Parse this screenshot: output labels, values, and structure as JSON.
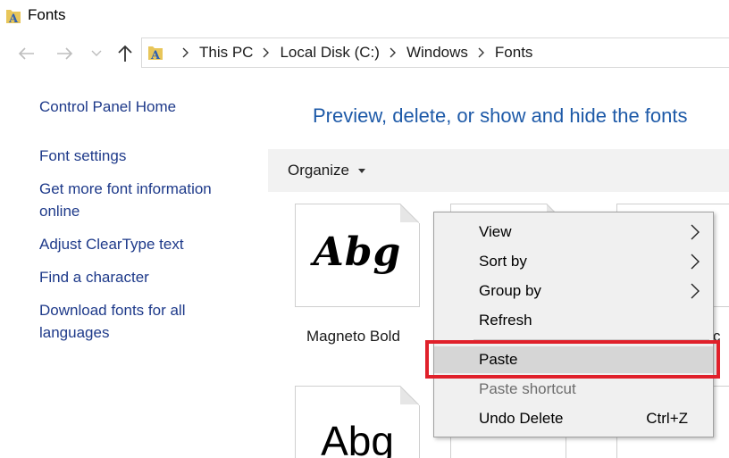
{
  "window": {
    "title": "Fonts",
    "title_icon": "fonts-folder-icon"
  },
  "nav": {
    "back_icon": "arrow-left-icon",
    "forward_icon": "arrow-right-icon",
    "recent_icon": "chevron-down-icon",
    "up_icon": "arrow-up-icon"
  },
  "address": {
    "crumbs": [
      "This PC",
      "Local Disk (C:)",
      "Windows",
      "Fonts"
    ]
  },
  "sidebar": {
    "home": "Control Panel Home",
    "links": [
      "Font settings",
      "Get more font information online",
      "Adjust ClearType text",
      "Find a character",
      "Download fonts for all languages"
    ]
  },
  "main": {
    "heading": "Preview, delete, or show and hide the fonts",
    "organize_label": "Organize",
    "tiles": [
      {
        "name": "Magneto Bold",
        "preview": "Abg"
      },
      {
        "name": "",
        "preview": "Abg"
      }
    ],
    "partial_label_char": "c"
  },
  "context_menu": {
    "items": [
      {
        "label": "View",
        "submenu": true
      },
      {
        "label": "Sort by",
        "submenu": true
      },
      {
        "label": "Group by",
        "submenu": true
      },
      {
        "label": "Refresh"
      },
      {
        "label": "Paste",
        "highlighted": true
      },
      {
        "label": "Paste shortcut",
        "disabled": true
      },
      {
        "label": "Undo Delete",
        "accelerator": "Ctrl+Z"
      }
    ]
  },
  "colors": {
    "link": "#1e3a8a",
    "heading": "#1e5aa8",
    "highlight_border": "#e0202a"
  }
}
